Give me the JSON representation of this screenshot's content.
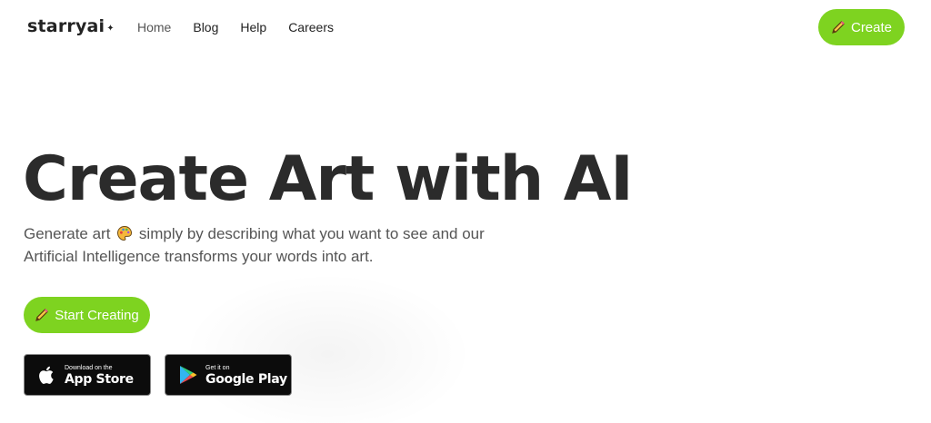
{
  "header": {
    "logo_text": "starryai",
    "logo_mark": "✦",
    "nav": [
      {
        "label": "Home",
        "active": true
      },
      {
        "label": "Blog"
      },
      {
        "label": "Help"
      },
      {
        "label": "Careers"
      }
    ],
    "create_label": "Create",
    "create_icon": "pencil-icon"
  },
  "hero": {
    "title": "Create Art with AI",
    "subtitle_part1": "Generate art",
    "subtitle_icon": "palette-icon",
    "subtitle_part2": "simply by describing what you want to see and our Artificial Intelligence transforms your words into art.",
    "start_label": "Start Creating"
  },
  "badges": {
    "apple_small": "Download on the",
    "apple_big": "App Store",
    "google_small": "Get it on",
    "google_big": "Google Play"
  },
  "colors": {
    "accent": "#7ed320",
    "text": "#2b2b2b",
    "badge_bg": "#0c0c0c"
  }
}
